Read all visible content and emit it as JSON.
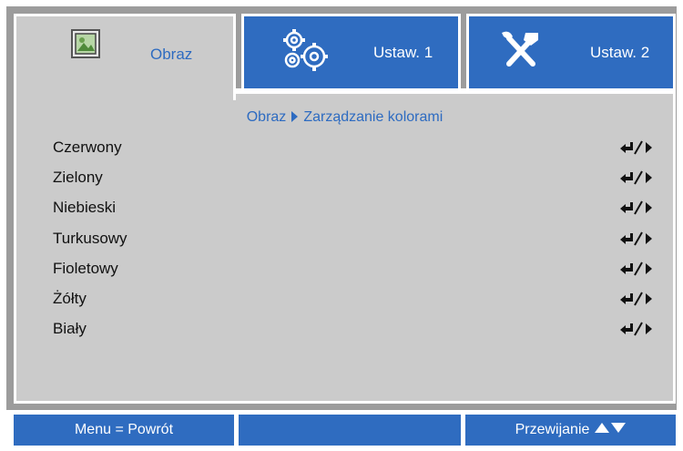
{
  "tabs": [
    {
      "label": "Obraz",
      "icon": "picture-icon",
      "active": true
    },
    {
      "label": "Ustaw. 1",
      "icon": "gears-icon",
      "active": false
    },
    {
      "label": "Ustaw. 2",
      "icon": "tools-icon",
      "active": false
    }
  ],
  "breadcrumb": {
    "parent": "Obraz",
    "current": "Zarządzanie kolorami"
  },
  "menu": [
    {
      "label": "Czerwony",
      "action_icon": "enter-right-icon"
    },
    {
      "label": "Zielony",
      "action_icon": "enter-right-icon"
    },
    {
      "label": "Niebieski",
      "action_icon": "enter-right-icon"
    },
    {
      "label": "Turkusowy",
      "action_icon": "enter-right-icon"
    },
    {
      "label": "Fioletowy",
      "action_icon": "enter-right-icon"
    },
    {
      "label": "Żółty",
      "action_icon": "enter-right-icon"
    },
    {
      "label": "Biały",
      "action_icon": "enter-right-icon"
    }
  ],
  "footer": {
    "left": "Menu = Powrót",
    "middle": "",
    "right": "Przewijanie"
  },
  "colors": {
    "accent": "#2f6cc0",
    "panel": "#cbcbcb",
    "frame": "#9c9c9c",
    "text_blue": "#2d6bc1"
  }
}
